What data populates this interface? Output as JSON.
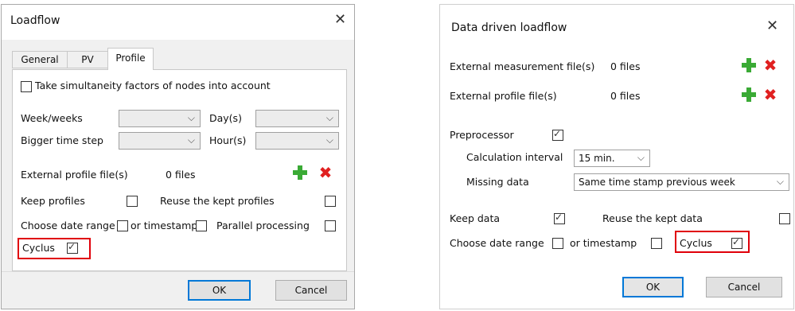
{
  "left_dialog": {
    "title": "Loadflow",
    "close_icon": "close-icon",
    "tabs": [
      "General",
      "PV",
      "Profile"
    ],
    "simultaneity_label": "Take simultaneity factors of nodes into account",
    "week_label": "Week/weeks",
    "day_label": "Day(s)",
    "bigger_step_label": "Bigger time step",
    "hour_label": "Hour(s)",
    "ext_profile_label": "External profile file(s)",
    "ext_profile_count": "0 files",
    "keep_profiles_label": "Keep profiles",
    "reuse_profiles_label": "Reuse the kept profiles",
    "choose_date_label": "Choose date range",
    "or_timestamp_label": "or timestamp",
    "parallel_label": "Parallel processing",
    "cyclus_label": "Cyclus",
    "ok_label": "OK",
    "cancel_label": "Cancel"
  },
  "right_dialog": {
    "title": "Data driven loadflow",
    "close_icon": "close-icon",
    "ext_measure_label": "External measurement file(s)",
    "ext_measure_count": "0 files",
    "ext_profile_label": "External profile file(s)",
    "ext_profile_count": "0 files",
    "preprocessor_label": "Preprocessor",
    "calc_interval_label": "Calculation interval",
    "calc_interval_value": "15 min.",
    "missing_data_label": "Missing data",
    "missing_data_value": "Same time stamp previous week",
    "keep_data_label": "Keep data",
    "reuse_data_label": "Reuse the kept data",
    "choose_date_label": "Choose date range",
    "or_timestamp_label": "or timestamp",
    "cyclus_label": "Cyclus",
    "ok_label": "OK",
    "cancel_label": "Cancel"
  },
  "colors": {
    "highlight": "#e0000a",
    "add": "#3aaa35",
    "remove": "#e02020",
    "default_button": "#0078d7"
  }
}
